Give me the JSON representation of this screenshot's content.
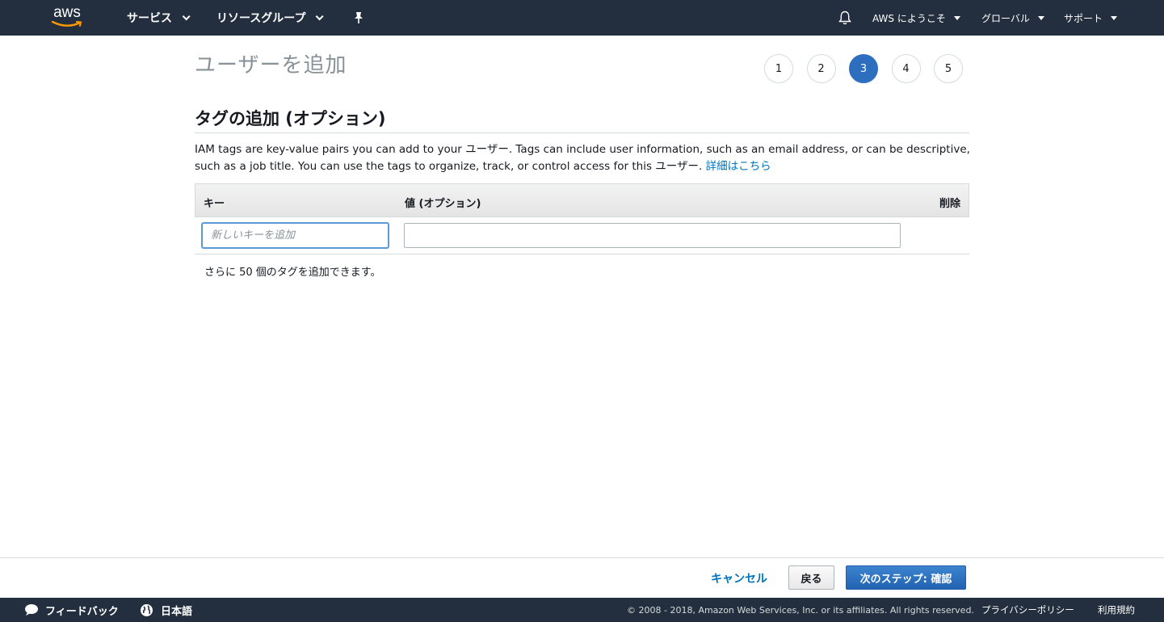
{
  "topnav": {
    "logo_text": "aws",
    "services": "サービス",
    "resource_groups": "リソースグループ",
    "pin_icon": "pushpin-icon",
    "bell_icon": "bell-icon",
    "account": "AWS にようこそ",
    "region": "グローバル",
    "support": "サポート"
  },
  "page": {
    "title": "ユーザーを追加",
    "steps": [
      "1",
      "2",
      "3",
      "4",
      "5"
    ],
    "active_step": 3
  },
  "section": {
    "title": "タグの追加 (オプション)",
    "description": "IAM tags are key-value pairs you can add to your ユーザー. Tags can include user information, such as an email address, or can be descriptive, such as a job title. You can use the tags to organize, track, or control access for this ユーザー.",
    "learn_more": "詳細はこちら"
  },
  "table": {
    "col_key": "キー",
    "col_value": "値 (オプション)",
    "col_delete": "削除",
    "key_placeholder": "新しいキーを追加",
    "key_value": "",
    "value_value": ""
  },
  "remaining_text": "さらに 50 個のタグを追加できます。",
  "footer_buttons": {
    "cancel": "キャンセル",
    "back": "戻る",
    "next": "次のステップ: 確認"
  },
  "bottombar": {
    "feedback": "フィードバック",
    "language": "日本語",
    "copyright": "© 2008 - 2018, Amazon Web Services, Inc. or its affiliates. All rights reserved.",
    "privacy": "プライバシーポリシー",
    "terms": "利用規約"
  },
  "colors": {
    "nav_bg": "#232f3e",
    "accent": "#2e6ebf",
    "link": "#0073bb",
    "logo_smile": "#ff9900"
  }
}
